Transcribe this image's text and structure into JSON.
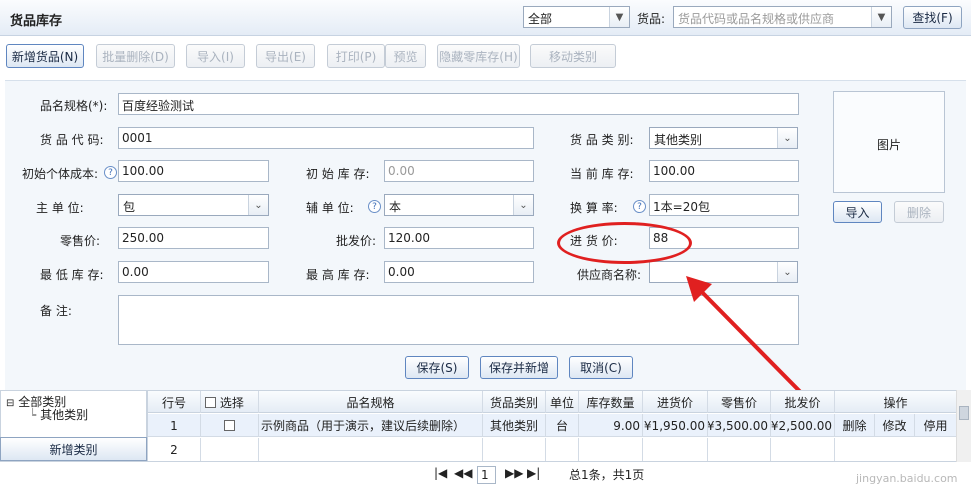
{
  "header": {
    "title": "货品库存",
    "category_select": "全部",
    "goods_label": "货品:",
    "goods_placeholder": "货品代码或品名规格或供应商",
    "search_button": "查找(F)"
  },
  "toolbar": {
    "new_goods": "新增货品(N)",
    "batch_delete": "批量删除(D)",
    "import": "导入(I)",
    "export": "导出(E)",
    "print": "打印(P)",
    "preview": "预览",
    "hide_zero_stock": "隐藏零库存(H)",
    "move_category": "移动类别"
  },
  "form": {
    "name_label": "品名规格(*):",
    "name_value": "百度经验测试",
    "code_label": "货 品 代 码:",
    "code_value": "0001",
    "category_label": "货 品 类 别:",
    "category_value": "其他类别",
    "init_cost_label": "初始个体成本:",
    "init_cost_value": "100.00",
    "init_stock_label": "初 始 库 存:",
    "init_stock_value": "0.00",
    "current_stock_label": "当 前 库 存:",
    "current_stock_value": "100.00",
    "main_unit_label": "主 单 位:",
    "main_unit_value": "包",
    "aux_unit_label": "辅 单 位:",
    "aux_unit_value": "本",
    "conversion_label": "换 算 率:",
    "conversion_value": "1本=20包",
    "retail_label": "零售价:",
    "retail_value": "250.00",
    "wholesale_label": "批发价:",
    "wholesale_value": "120.00",
    "purchase_label": "进 货 价:",
    "purchase_value": "88",
    "min_stock_label": "最 低 库 存:",
    "min_stock_value": "0.00",
    "max_stock_label": "最 高 库 存:",
    "max_stock_value": "0.00",
    "supplier_label": "供应商名称:",
    "supplier_value": "",
    "remark_label": "备 注:",
    "remark_value": ""
  },
  "photo": {
    "label": "图片",
    "import": "导入",
    "delete": "删除"
  },
  "actions": {
    "save": "保存(S)",
    "save_new": "保存并新增",
    "cancel": "取消(C)"
  },
  "tree": {
    "root": "全部类别",
    "child": "其他类别",
    "add_button": "新增类别"
  },
  "grid": {
    "headers": [
      "行号",
      "选择",
      "品名规格",
      "货品类别",
      "单位",
      "库存数量",
      "进货价",
      "零售价",
      "批发价",
      "操作"
    ],
    "rows": [
      {
        "no": "1",
        "name": "示例商品（用于演示，建议后续删除）",
        "category": "其他类别",
        "unit": "台",
        "qty": "9.00",
        "purchase": "¥1,950.00",
        "retail": "¥3,500.00",
        "wholesale": "¥2,500.00",
        "op_delete": "删除",
        "op_edit": "修改",
        "op_disable": "停用"
      },
      {
        "no": "2"
      }
    ]
  },
  "pager": {
    "page": "1",
    "summary": "总1条，共1页",
    "first": "|◀",
    "prev": "◀◀",
    "next": "▶▶",
    "last": "▶|"
  },
  "watermark": "jingyan.baidu.com",
  "colors": {
    "annotation": "#e02020",
    "accent": "#5f86c0"
  }
}
